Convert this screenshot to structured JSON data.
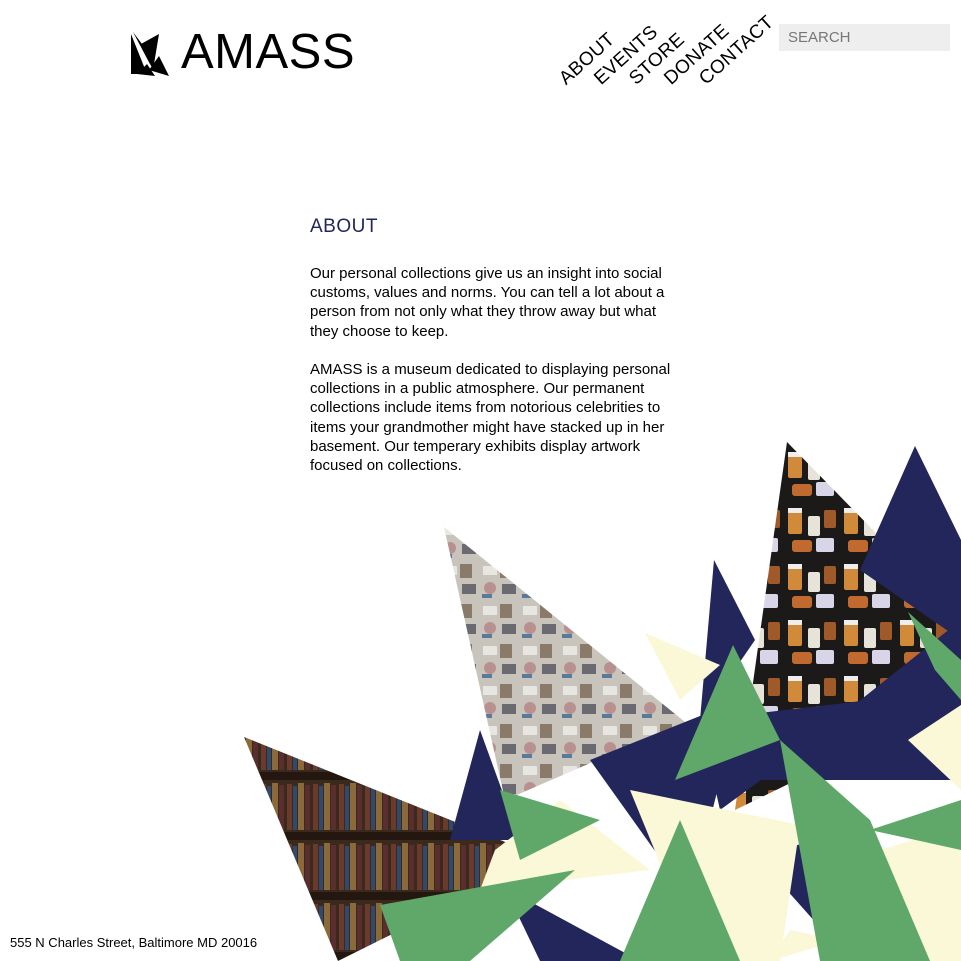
{
  "brand": {
    "name": "AMASS",
    "logo_icon": "bird-icon"
  },
  "nav": {
    "items": [
      {
        "label": "ABOUT"
      },
      {
        "label": "EVENTS"
      },
      {
        "label": "STORE"
      },
      {
        "label": "DONATE"
      },
      {
        "label": "CONTACT"
      }
    ]
  },
  "search": {
    "placeholder": "SEARCH",
    "value": ""
  },
  "main": {
    "title": "ABOUT",
    "paragraphs": [
      "Our personal collections give us an insight into social customs, values and norms. You can tell a lot about a person from not only what they throw away but what they choose to keep.",
      "AMASS is a museum dedicated to displaying personal collections in a public atmosphere. Our permanent collections include items from notorious celebrities to items your grandmother might have stacked up in her basement. Our temperary exhibits display artwork focused on collections."
    ]
  },
  "footer": {
    "address": "555 N Charles Street, Baltimore MD 20016"
  },
  "colors": {
    "navy": "#22265a",
    "green": "#5fa86a",
    "cream": "#fbf8d8",
    "title": "#23265a",
    "search_bg": "#eeeeee"
  }
}
